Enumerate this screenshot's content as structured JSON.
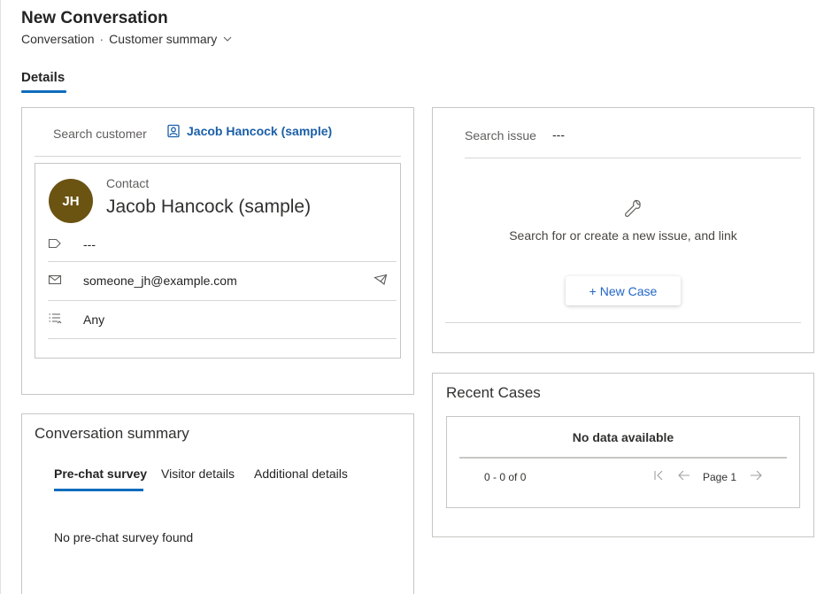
{
  "header": {
    "title": "New Conversation",
    "breadcrumb_entity": "Conversation",
    "breadcrumb_separator": "·",
    "breadcrumb_form": "Customer summary"
  },
  "tabs": {
    "details": "Details"
  },
  "customer": {
    "search_label": "Search customer",
    "selected_customer": "Jacob Hancock (sample)",
    "avatar_initials": "JH",
    "avatar_color": "#6b5312",
    "contact_type": "Contact",
    "contact_name": "Jacob Hancock (sample)",
    "tag_value": "---",
    "email": "someone_jh@example.com",
    "preferred_contact": "Any"
  },
  "issue": {
    "search_label": "Search issue",
    "search_value": "---",
    "empty_message": "Search for or create a new issue, and link",
    "new_case_label": "+ New Case"
  },
  "conversation_summary": {
    "title": "Conversation summary",
    "tabs": [
      "Pre-chat survey",
      "Visitor details",
      "Additional details"
    ],
    "active_tab": "Pre-chat survey",
    "empty_message": "No pre-chat survey found"
  },
  "recent_cases": {
    "title": "Recent Cases",
    "empty_message": "No data available",
    "record_count": "0 - 0 of 0",
    "page_label": "Page 1"
  },
  "colors": {
    "accent": "#0f6cbd",
    "link": "#1a5fa8",
    "border": "#c8c6c4"
  }
}
